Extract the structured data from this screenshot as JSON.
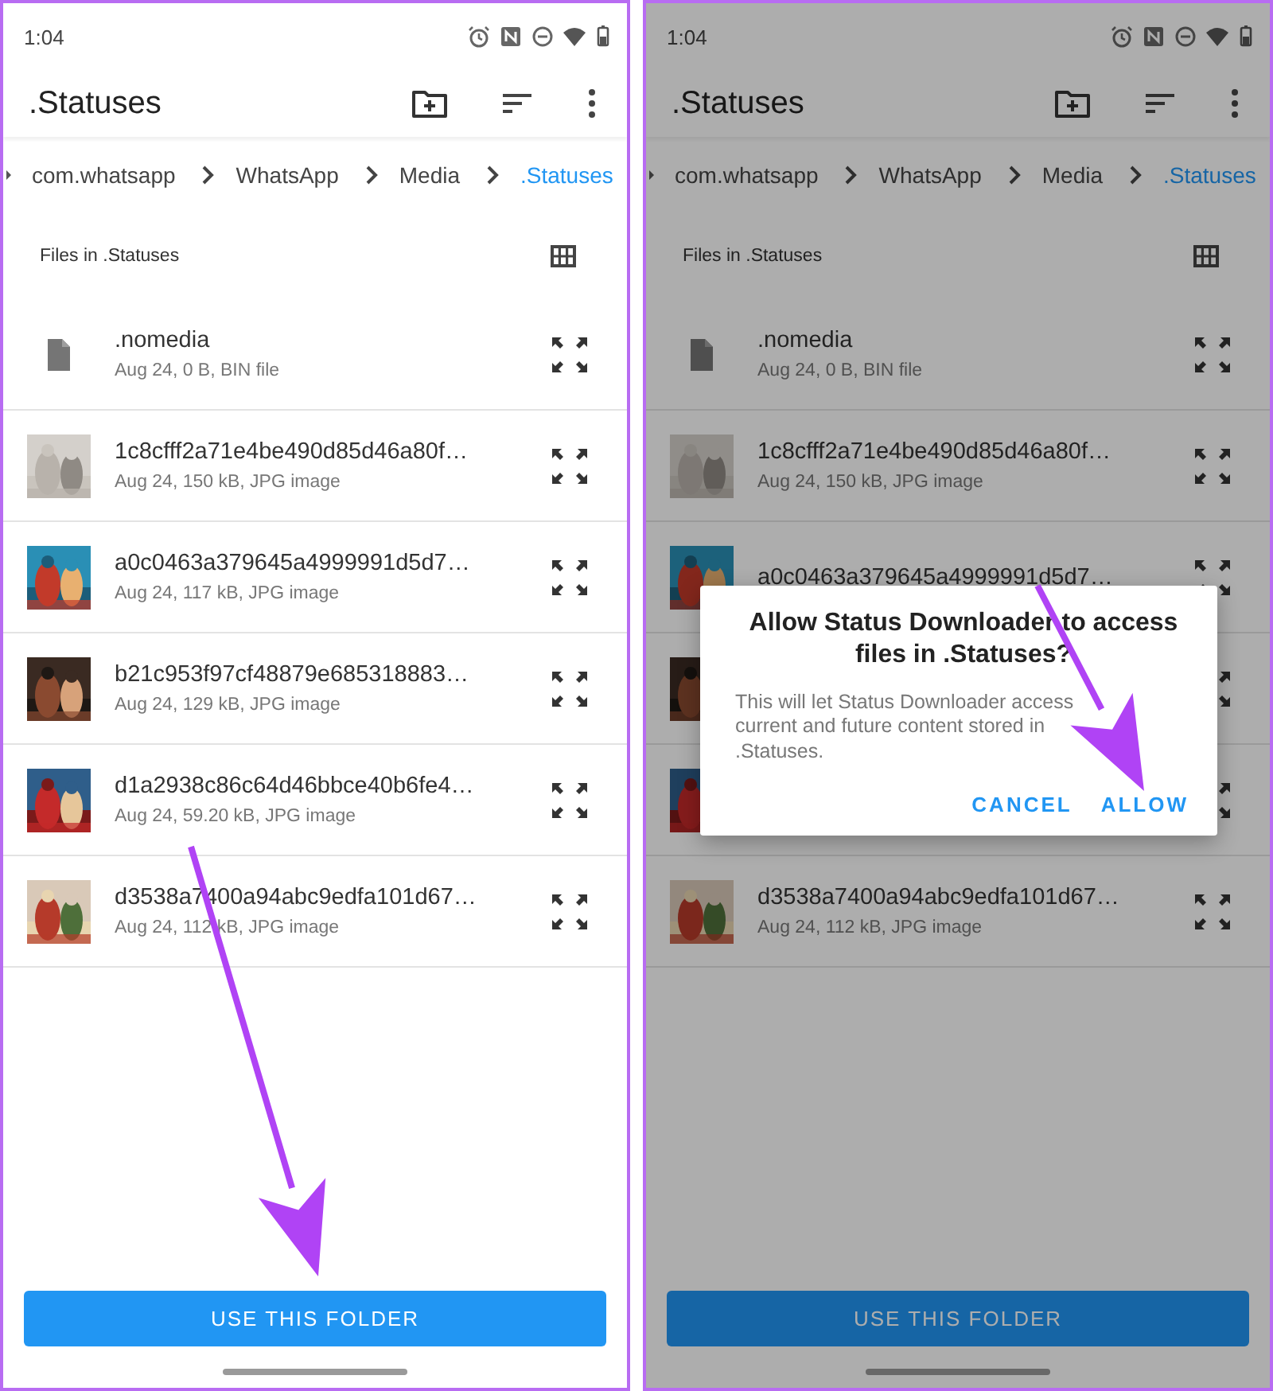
{
  "screens": [
    {
      "dimmed": false,
      "annotation_arrow": true,
      "status_bar": {
        "time": "1:04"
      },
      "title": ".Statuses",
      "breadcrumb": [
        {
          "label": "com.whatsapp",
          "selected": false
        },
        {
          "label": "WhatsApp",
          "selected": false
        },
        {
          "label": "Media",
          "selected": false
        },
        {
          "label": ".Statuses",
          "selected": true
        }
      ],
      "files_heading": "Files in .Statuses",
      "files": [
        {
          "kind": "file",
          "name": ".nomedia",
          "meta": "Aug 24, 0 B, BIN file"
        },
        {
          "kind": "picture",
          "name": "1c8cfff2a71e4be490d85d46a80f…",
          "meta": "Aug 24, 150 kB, JPG image"
        },
        {
          "kind": "picture",
          "name": "a0c0463a379645a4999991d5d7…",
          "meta": "Aug 24, 117 kB, JPG image"
        },
        {
          "kind": "picture",
          "name": "b21c953f97cf48879e685318883…",
          "meta": "Aug 24, 129 kB, JPG image"
        },
        {
          "kind": "picture",
          "name": "d1a2938c86c64d46bbce40b6fe4…",
          "meta": "Aug 24, 59.20 kB, JPG image"
        },
        {
          "kind": "picture",
          "name": "d3538a7400a94abc9edfa101d67…",
          "meta": "Aug 24, 112 kB, JPG image"
        }
      ],
      "action_button": "USE THIS FOLDER"
    },
    {
      "dimmed": true,
      "annotation_arrow": true,
      "status_bar": {
        "time": "1:04"
      },
      "title": ".Statuses",
      "breadcrumb": [
        {
          "label": "com.whatsapp",
          "selected": false
        },
        {
          "label": "WhatsApp",
          "selected": false
        },
        {
          "label": "Media",
          "selected": false
        },
        {
          "label": ".Statuses",
          "selected": true
        }
      ],
      "files_heading": "Files in .Statuses",
      "files": [
        {
          "kind": "file",
          "name": ".nomedia",
          "meta": "Aug 24, 0 B, BIN file"
        },
        {
          "kind": "picture",
          "name": "1c8cfff2a71e4be490d85d46a80f…",
          "meta": "Aug 24, 150 kB, JPG image"
        },
        {
          "kind": "picture",
          "name": "a0c0463a379645a4999991d5d7…"
        },
        {
          "kind": "picture"
        },
        {
          "kind": "picture"
        },
        {
          "kind": "picture",
          "name": "d3538a7400a94abc9edfa101d67…",
          "meta": "Aug 24, 112 kB, JPG image"
        }
      ],
      "action_button": "USE THIS FOLDER",
      "dialog": {
        "title": "Allow Status Downloader to access files in .Statuses?",
        "message": "This will let Status Downloader access current and future content stored in .Statuses.",
        "buttons": [
          "CANCEL",
          "ALLOW"
        ]
      }
    }
  ]
}
